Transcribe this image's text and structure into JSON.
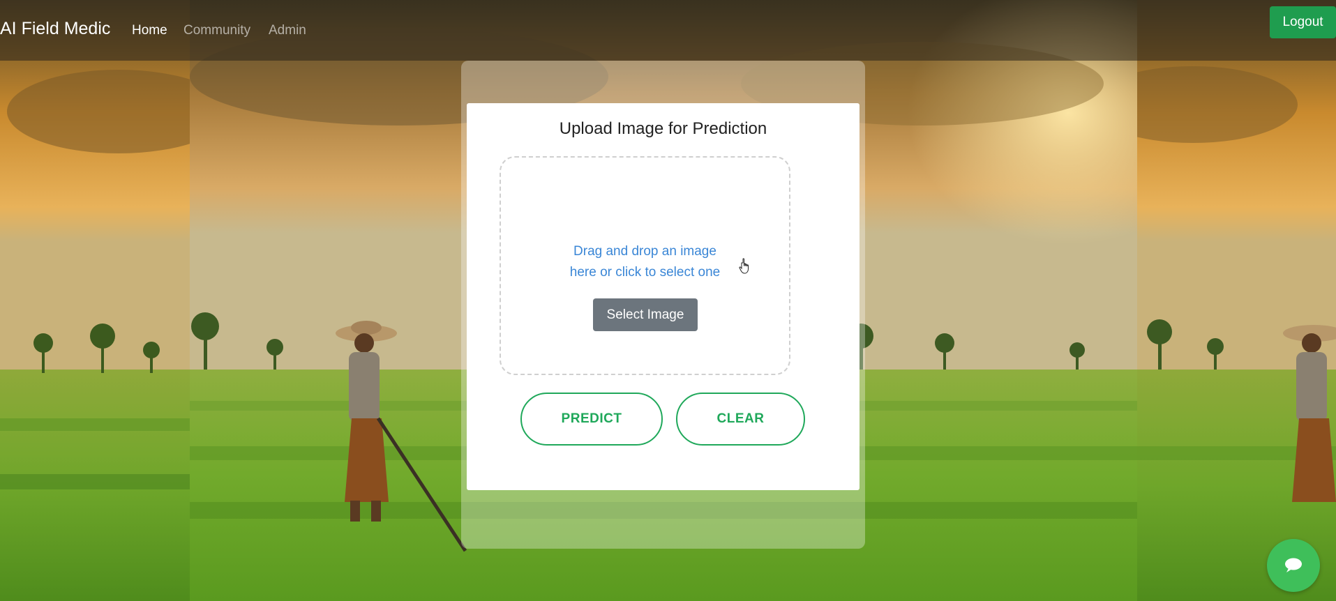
{
  "navbar": {
    "brand": "AI Field Medic",
    "links": [
      {
        "label": "Home",
        "active": true
      },
      {
        "label": "Community",
        "active": false
      },
      {
        "label": "Admin",
        "active": false
      }
    ],
    "logout_label": "Logout",
    "logout_color": "#1f9d4f"
  },
  "upload": {
    "title": "Upload Image for Prediction",
    "drop_line1": "Drag and drop an image",
    "drop_line2": "here or click to select one",
    "select_label": "Select Image",
    "predict_label": "PREDICT",
    "clear_label": "CLEAR",
    "accent_color": "#1fa85a",
    "link_color": "#3a86d6"
  },
  "chat": {
    "icon": "chat-bubble-icon",
    "color": "#3fbf5a"
  },
  "background": {
    "icon": "rice-field-farmer-scene"
  }
}
